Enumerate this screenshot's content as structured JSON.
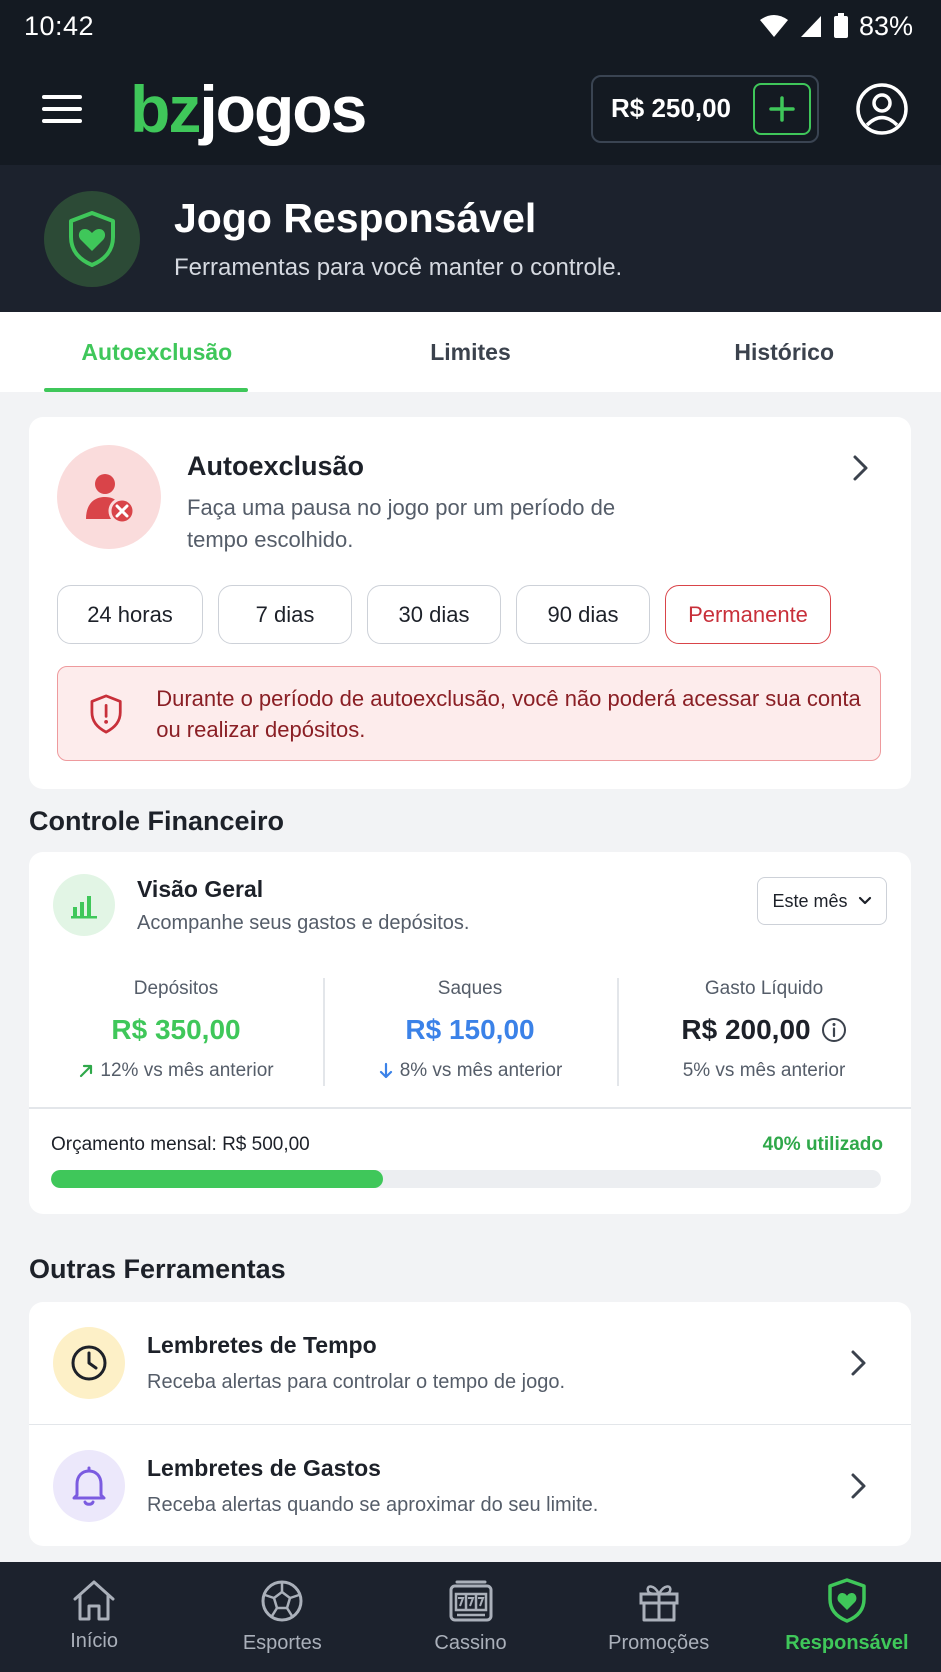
{
  "status_bar": {
    "time": "10:42",
    "battery": "83%"
  },
  "header": {
    "logo_part1": "bz",
    "logo_part2": "jogos",
    "balance": "R$ 250,00"
  },
  "hero": {
    "title": "Jogo Responsável",
    "subtitle": "Ferramentas para você manter o controle."
  },
  "tabs": [
    {
      "label": "Autoexclusão",
      "active": true
    },
    {
      "label": "Limites",
      "active": false
    },
    {
      "label": "Histórico",
      "active": false
    }
  ],
  "self_exclusion": {
    "title": "Autoexclusão",
    "description": "Faça uma pausa no jogo por um período de tempo escolhido.",
    "periods": [
      "24 horas",
      "7 dias",
      "30 dias",
      "90 dias",
      "Permanente"
    ],
    "warning": "Durante o período de autoexclusão, você não poderá acessar sua conta ou realizar depósitos."
  },
  "finance": {
    "section_title": "Controle Financeiro",
    "card_title": "Visão Geral",
    "card_subtitle": "Acompanhe seus gastos e depósitos.",
    "period_select": "Este mês",
    "stats": [
      {
        "label": "Depósitos",
        "value": "R$ 350,00",
        "delta": "12% vs mês anterior",
        "color": "#3fc75a"
      },
      {
        "label": "Saques",
        "value": "R$ 150,00",
        "delta": "8% vs mês anterior",
        "color": "#3b82e8"
      },
      {
        "label": "Gasto Líquido",
        "value": "R$ 200,00",
        "delta": "5% vs mês anterior",
        "color": "#1d2129"
      }
    ],
    "budget_label": "Orçamento mensal: R$ 500,00",
    "budget_used_text": "40% utilizado",
    "budget_used_fraction": 0.4
  },
  "other_tools": {
    "section_title": "Outras Ferramentas",
    "items": [
      {
        "title": "Lembretes de Tempo",
        "description": "Receba alertas para controlar o tempo de jogo.",
        "icon": "clock-icon"
      },
      {
        "title": "Lembretes de Gastos",
        "description": "Receba alertas quando se aproximar do seu limite.",
        "icon": "bell-icon"
      }
    ]
  },
  "bottom_nav": [
    {
      "label": "Início",
      "icon": "home-icon",
      "active": false
    },
    {
      "label": "Esportes",
      "icon": "soccer-ball-icon",
      "active": false
    },
    {
      "label": "Cassino",
      "icon": "slot-machine-icon",
      "active": false
    },
    {
      "label": "Promoções",
      "icon": "gift-icon",
      "active": false
    },
    {
      "label": "Responsável",
      "icon": "shield-heart-icon",
      "active": true
    }
  ],
  "colors": {
    "accent": "#3fc75a",
    "danger": "#c8303a",
    "header_bg": "#141a22"
  }
}
